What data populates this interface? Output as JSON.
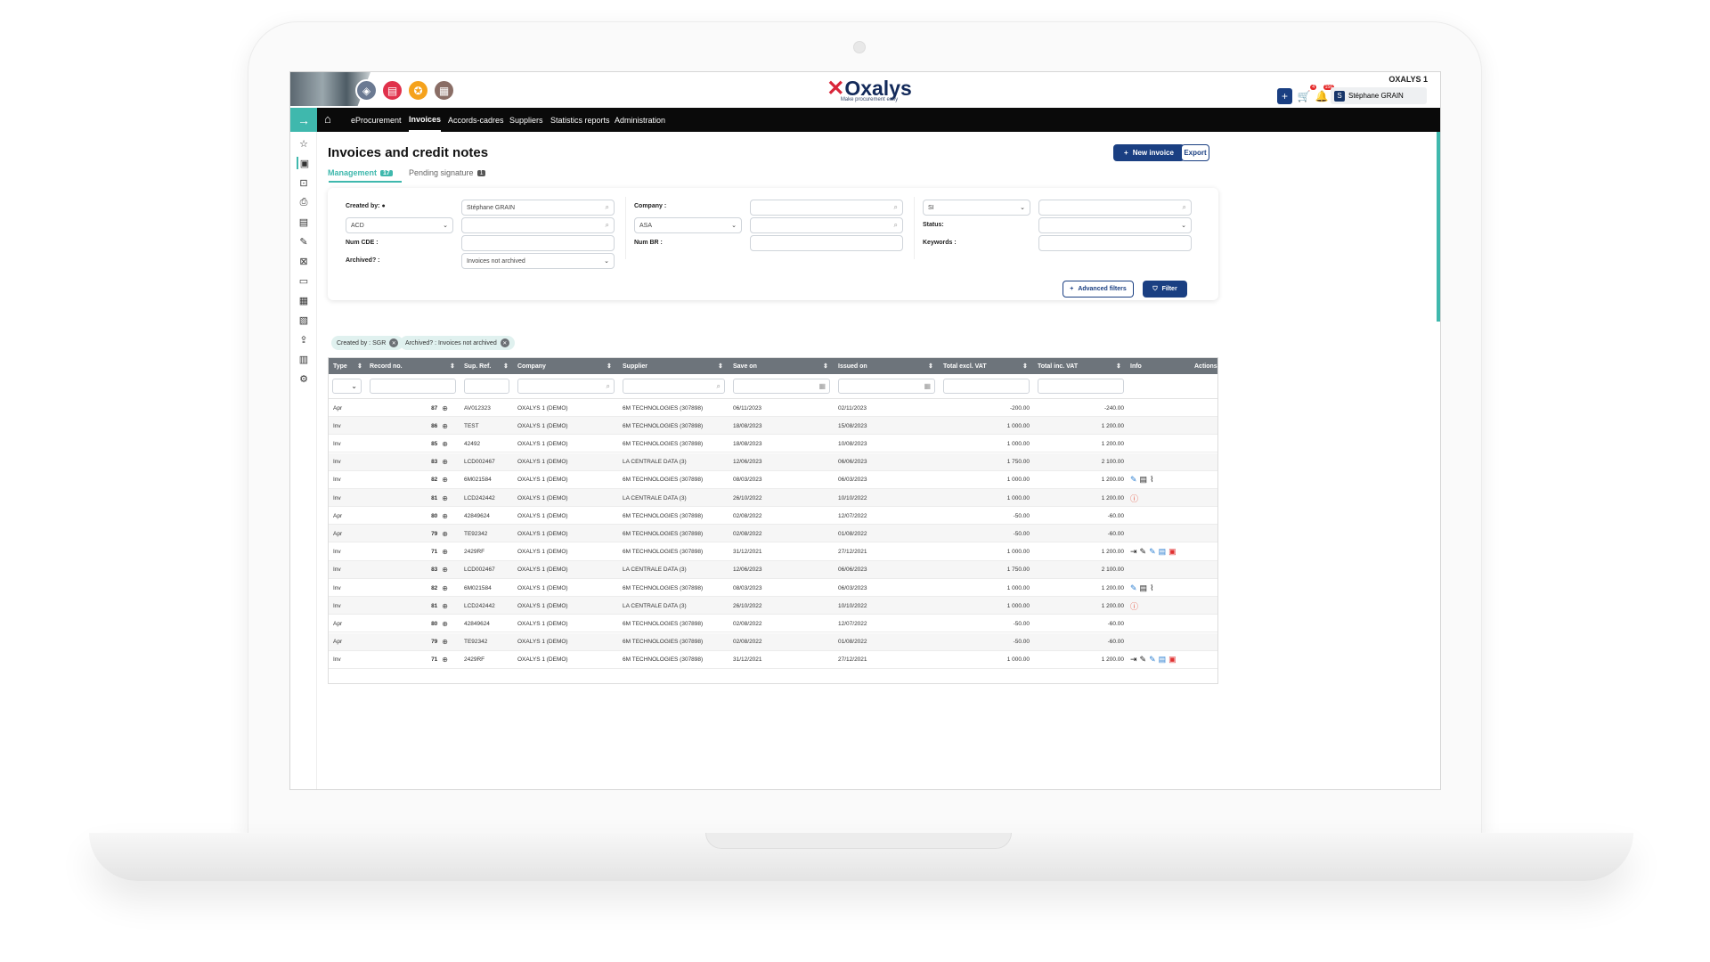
{
  "env_name": "OXALYS 1",
  "logo": {
    "name": "Oxalys",
    "tagline": "Make procurement easy"
  },
  "header": {
    "cart_badge": "4",
    "bell_badge": "156",
    "user_initial": "S",
    "user_name": "Stéphane GRAIN"
  },
  "nav": [
    "eProcurement",
    "Invoices",
    "Accords-cadres",
    "Suppliers",
    "Statistics reports",
    "Administration"
  ],
  "page": {
    "title": "Invoices and credit notes",
    "new_invoice": "New invoice",
    "export": "Export"
  },
  "tabs": [
    {
      "label": "Management",
      "count": "17"
    },
    {
      "label": "Pending signature",
      "count": "1"
    }
  ],
  "filters": {
    "created_by_label": "Created by:",
    "created_by_value": "Stéphane GRAIN",
    "acd": "ACD",
    "num_cde_label": "Num CDE :",
    "archived_label": "Archived? :",
    "archived_value": "Invoices not archived",
    "company_label": "Company :",
    "asa": "ASA",
    "num_br_label": "Num BR :",
    "si": "SI",
    "status_label": "Status:",
    "keywords_label": "Keywords :",
    "advanced": "Advanced filters",
    "filter": "Filter"
  },
  "chips": [
    "Created by : SGR",
    "Archived? : Invoices not archived"
  ],
  "columns": [
    "Type",
    "Record no.",
    "Sup. Ref.",
    "Company",
    "Supplier",
    "Save on",
    "Issued on",
    "Total excl. VAT",
    "Total inc. VAT",
    "Info",
    "Actions"
  ],
  "rows": [
    {
      "type": "Apr",
      "rec": "87",
      "ref": "AV012323",
      "company": "OXALYS 1 (DEMO)",
      "supplier": "6M TECHNOLOGIES (307898)",
      "save": "06/11/2023",
      "issued": "02/11/2023",
      "excl": "-200.00",
      "inc": "-240.00",
      "info": []
    },
    {
      "type": "Inv",
      "rec": "86",
      "ref": "TEST",
      "company": "OXALYS 1 (DEMO)",
      "supplier": "6M TECHNOLOGIES (307898)",
      "save": "18/08/2023",
      "issued": "15/08/2023",
      "excl": "1 000.00",
      "inc": "1 200.00",
      "info": []
    },
    {
      "type": "Inv",
      "rec": "85",
      "ref": "42492",
      "company": "OXALYS 1 (DEMO)",
      "supplier": "6M TECHNOLOGIES (307898)",
      "save": "18/08/2023",
      "issued": "10/08/2023",
      "excl": "1 000.00",
      "inc": "1 200.00",
      "info": []
    },
    {
      "type": "Inv",
      "rec": "83",
      "ref": "LCD002467",
      "company": "OXALYS 1 (DEMO)",
      "supplier": "LA CENTRALE DATA (3)",
      "save": "12/06/2023",
      "issued": "06/06/2023",
      "excl": "1 750.00",
      "inc": "2 100.00",
      "info": []
    },
    {
      "type": "Inv",
      "rec": "82",
      "ref": "6M021584",
      "company": "OXALYS 1 (DEMO)",
      "supplier": "6M TECHNOLOGIES (307898)",
      "save": "08/03/2023",
      "issued": "06/03/2023",
      "excl": "1 000.00",
      "inc": "1 200.00",
      "info": [
        "edit-blue",
        "doc",
        "clip"
      ]
    },
    {
      "type": "Inv",
      "rec": "81",
      "ref": "LCD242442",
      "company": "OXALYS 1 (DEMO)",
      "supplier": "LA CENTRALE DATA (3)",
      "save": "26/10/2022",
      "issued": "10/10/2022",
      "excl": "1 000.00",
      "inc": "1 200.00",
      "info": [
        "warn"
      ]
    },
    {
      "type": "Apr",
      "rec": "80",
      "ref": "42849624",
      "company": "OXALYS 1 (DEMO)",
      "supplier": "6M TECHNOLOGIES (307898)",
      "save": "02/08/2022",
      "issued": "12/07/2022",
      "excl": "-50.00",
      "inc": "-60.00",
      "info": []
    },
    {
      "type": "Apr",
      "rec": "79",
      "ref": "TE92342",
      "company": "OXALYS 1 (DEMO)",
      "supplier": "6M TECHNOLOGIES (307898)",
      "save": "02/08/2022",
      "issued": "01/08/2022",
      "excl": "-50.00",
      "inc": "-60.00",
      "info": []
    },
    {
      "type": "Inv",
      "rec": "71",
      "ref": "2429RF",
      "company": "OXALYS 1 (DEMO)",
      "supplier": "6M TECHNOLOGIES (307898)",
      "save": "31/12/2021",
      "issued": "27/12/2021",
      "excl": "1 000.00",
      "inc": "1 200.00",
      "info": [
        "export",
        "edit",
        "edit-blue",
        "doc-blue",
        "pdf"
      ]
    },
    {
      "type": "Inv",
      "rec": "83",
      "ref": "LCD002467",
      "company": "OXALYS 1 (DEMO)",
      "supplier": "LA CENTRALE DATA (3)",
      "save": "12/06/2023",
      "issued": "06/06/2023",
      "excl": "1 750.00",
      "inc": "2 100.00",
      "info": []
    },
    {
      "type": "Inv",
      "rec": "82",
      "ref": "6M021584",
      "company": "OXALYS 1 (DEMO)",
      "supplier": "6M TECHNOLOGIES (307898)",
      "save": "08/03/2023",
      "issued": "06/03/2023",
      "excl": "1 000.00",
      "inc": "1 200.00",
      "info": [
        "edit-blue",
        "doc",
        "clip"
      ]
    },
    {
      "type": "Inv",
      "rec": "81",
      "ref": "LCD242442",
      "company": "OXALYS 1 (DEMO)",
      "supplier": "LA CENTRALE DATA (3)",
      "save": "26/10/2022",
      "issued": "10/10/2022",
      "excl": "1 000.00",
      "inc": "1 200.00",
      "info": [
        "warn"
      ]
    },
    {
      "type": "Apr",
      "rec": "80",
      "ref": "42849624",
      "company": "OXALYS 1 (DEMO)",
      "supplier": "6M TECHNOLOGIES (307898)",
      "save": "02/08/2022",
      "issued": "12/07/2022",
      "excl": "-50.00",
      "inc": "-60.00",
      "info": []
    },
    {
      "type": "Apr",
      "rec": "79",
      "ref": "TE92342",
      "company": "OXALYS 1 (DEMO)",
      "supplier": "6M TECHNOLOGIES (307898)",
      "save": "02/08/2022",
      "issued": "01/08/2022",
      "excl": "-50.00",
      "inc": "-60.00",
      "info": []
    },
    {
      "type": "Inv",
      "rec": "71",
      "ref": "2429RF",
      "company": "OXALYS 1 (DEMO)",
      "supplier": "6M TECHNOLOGIES (307898)",
      "save": "31/12/2021",
      "issued": "27/12/2021",
      "excl": "1 000.00",
      "inc": "1 200.00",
      "info": [
        "export",
        "edit",
        "edit-blue",
        "doc-blue",
        "pdf"
      ]
    }
  ],
  "colors": {
    "accent": "#3fb8ad",
    "primary": "#1a3f82",
    "header_bg": "#6d747b"
  }
}
